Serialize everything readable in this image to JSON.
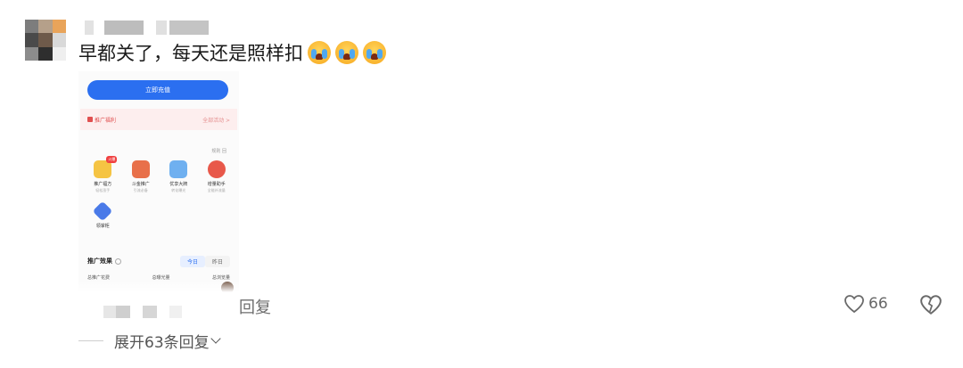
{
  "comment": {
    "text": "早都关了，每天还是照样扣",
    "emojis": [
      "crying-face-emoji",
      "crying-face-emoji",
      "crying-face-emoji"
    ]
  },
  "screenshot": {
    "recharge_button": "立即充值",
    "welfare_title": "推广福利",
    "welfare_more": "全部活动 >",
    "rules_link": "规则 回",
    "tools": [
      {
        "label": "推广福方",
        "sub": "轻松涨手",
        "badge": "火爆",
        "color": "#f5c443"
      },
      {
        "label": "斗金推广",
        "sub": "引流必备",
        "badge": "",
        "color": "#e8704a"
      },
      {
        "label": "优享大牌",
        "sub": "转化曝光",
        "badge": "",
        "color": "#6fb0f0"
      },
      {
        "label": "增量助手",
        "sub": "全能补流量",
        "badge": "",
        "color": "#e8584a"
      },
      {
        "label": "领掌柜",
        "sub": "",
        "badge": "",
        "color": "#4a7ae8"
      }
    ],
    "stats_title": "推广效果",
    "tab_today": "今日",
    "tab_yesterday": "昨日",
    "stat_labels": [
      "总推广花费",
      "总曝光量",
      "总浏览量"
    ]
  },
  "footer": {
    "reply_label": "回复",
    "like_count": "66",
    "expand_label": "展开63条回复"
  },
  "colors": {
    "accent_blue": "#2b6ff0",
    "welfare_red": "#e05050",
    "muted_text": "#6d6d6d"
  }
}
